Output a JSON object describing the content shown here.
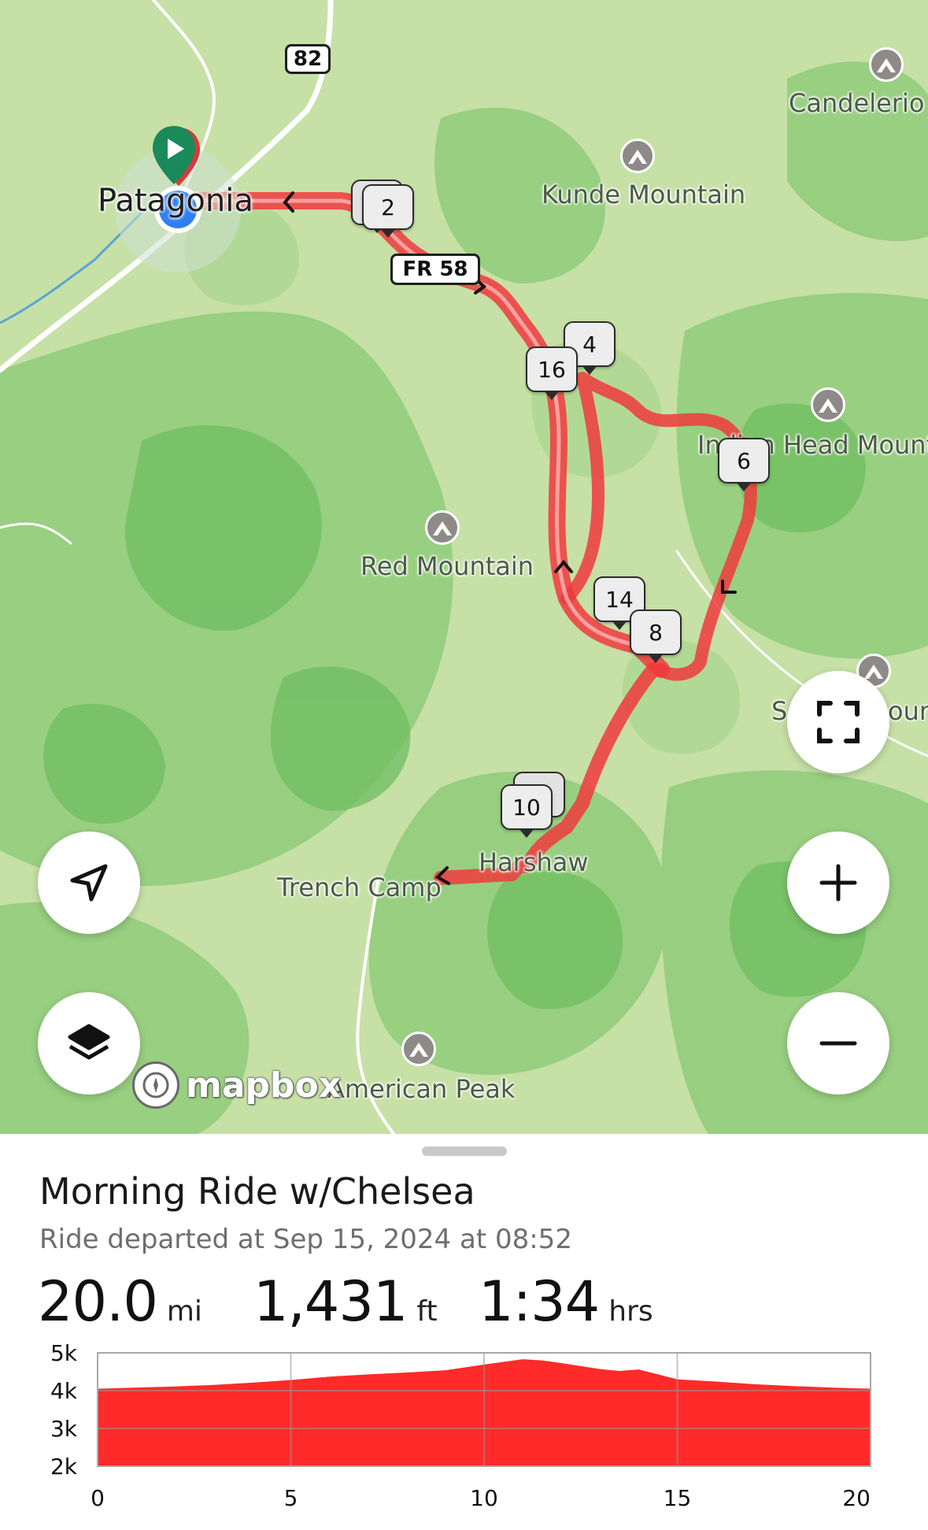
{
  "map": {
    "labels": {
      "candelerio": "Candelerio",
      "kunde": "Kunde Mountain",
      "town": "Patagonia",
      "indian_head": "Indian Head Mounta",
      "red_mountain": "Red Mountain",
      "sonoita_partial": "S",
      "sonoita_partial_right": "oun",
      "harshaw": "Harshaw",
      "trench_camp": "Trench Camp",
      "american_peak": "American Peak"
    },
    "shields": {
      "hwy": "82",
      "forest_road": "FR 58"
    },
    "mile_markers": [
      "2",
      "4",
      "6",
      "8",
      "10",
      "14",
      "16"
    ],
    "attribution": "mapbox",
    "route_color": "#f03a3d",
    "controls": {
      "locate": "navigation-arrow-icon",
      "layers": "layers-icon",
      "fullscreen": "fullscreen-icon",
      "zoom_in": "plus-icon",
      "zoom_out": "minus-icon"
    }
  },
  "ride": {
    "title": "Morning Ride w/Chelsea",
    "subtitle": "Ride departed at Sep 15, 2024 at 08:52",
    "distance_value": "20.0",
    "distance_unit": "mi",
    "elevation_value": "1,431",
    "elevation_unit": "ft",
    "time_value": "1:34",
    "time_unit": "hrs"
  },
  "chart_data": {
    "type": "area",
    "title": "",
    "xlabel": "",
    "ylabel": "",
    "x_ticks": [
      "0",
      "5",
      "10",
      "15",
      "20"
    ],
    "y_ticks": [
      "5k",
      "4k",
      "3k",
      "2k"
    ],
    "xlim": [
      0,
      20
    ],
    "ylim": [
      2000,
      5000
    ],
    "grid": true,
    "color": "#ff2a2a",
    "x": [
      0,
      1,
      2,
      3,
      4,
      5,
      6,
      7,
      8,
      9,
      10,
      10.5,
      11,
      11.5,
      12,
      13,
      13.5,
      14,
      14.5,
      15,
      16,
      17,
      18,
      19,
      20
    ],
    "y": [
      4050,
      4080,
      4110,
      4150,
      4210,
      4280,
      4370,
      4430,
      4480,
      4540,
      4690,
      4760,
      4830,
      4800,
      4730,
      4570,
      4520,
      4560,
      4430,
      4300,
      4240,
      4170,
      4120,
      4080,
      4050
    ]
  }
}
